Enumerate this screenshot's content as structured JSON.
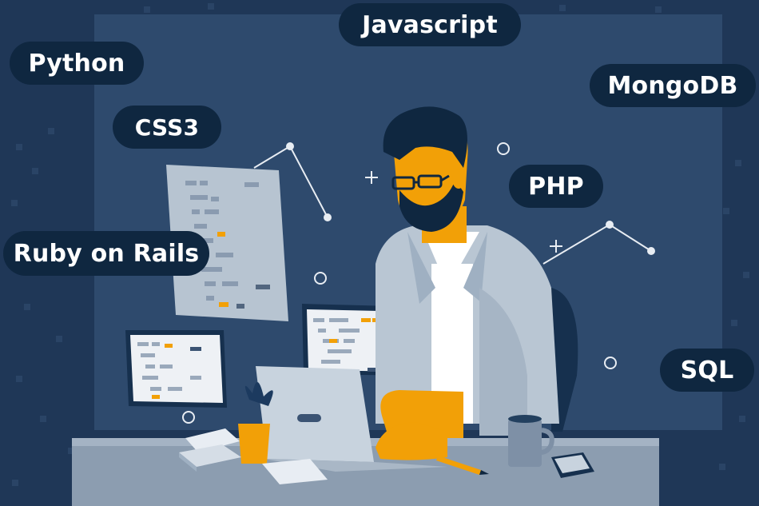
{
  "tags": {
    "javascript": "Javascript",
    "python": "Python",
    "mongodb": "MongoDB",
    "css3": "CSS3",
    "php": "PHP",
    "ruby_on_rails": "Ruby on Rails",
    "sql": "SQL"
  },
  "colors": {
    "background": "#1f3757",
    "panel": "#2e4a6d",
    "pill": "#0f2740",
    "skin": "#f2a007",
    "shirt": "#b9c6d3",
    "desk": "#8c9db0"
  },
  "icons": [
    "plus-icon",
    "circle-icon",
    "code-panel-icon",
    "laptop-icon",
    "mug-icon",
    "plant-icon",
    "pencil-icon"
  ]
}
